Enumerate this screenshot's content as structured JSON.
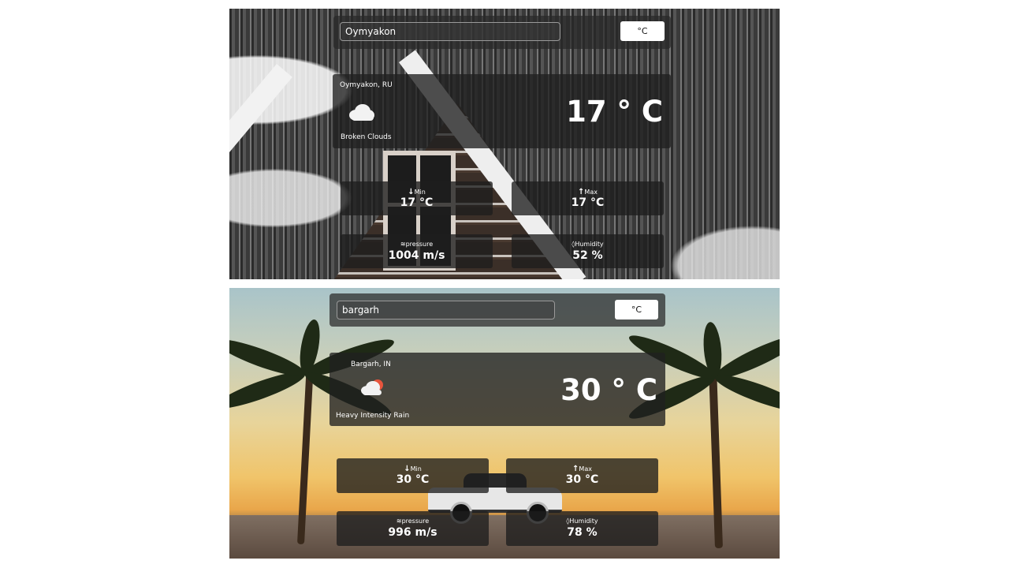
{
  "panels": [
    {
      "search_value": "Oymyakon",
      "unit_label": "°C",
      "location": "Oymyakon, RU",
      "condition": "Broken Clouds",
      "icon": "cloud-icon",
      "temperature": "17 ° C",
      "min_label": "Min",
      "min_value": "17 °C",
      "max_label": "Max",
      "max_value": "17 °C",
      "pressure_label": "pressure",
      "pressure_value": "1004 m/s",
      "humidity_label": "Humidity",
      "humidity_value": "52 %"
    },
    {
      "search_value": "bargarh",
      "unit_label": "°C",
      "location": "Bargarh, IN",
      "condition": "Heavy Intensity Rain",
      "icon": "cloud-sun-icon",
      "temperature": "30 ° C",
      "min_label": "Min",
      "min_value": "30 °C",
      "max_label": "Max",
      "max_value": "30 °C",
      "pressure_label": "pressure",
      "pressure_value": "996 m/s",
      "humidity_label": "Humidity",
      "humidity_value": "78 %"
    }
  ],
  "colors": {
    "card_bg": "#202020",
    "button_bg": "#ffffff",
    "text": "#ffffff"
  }
}
